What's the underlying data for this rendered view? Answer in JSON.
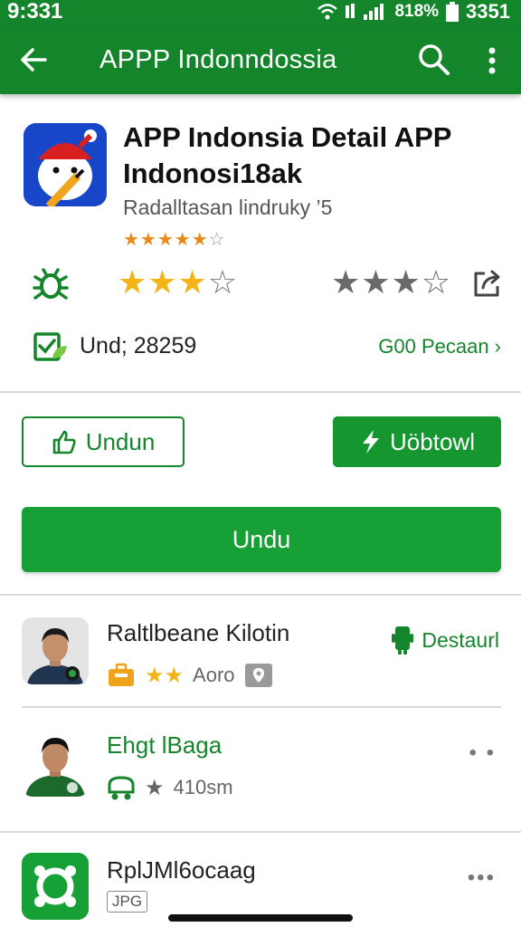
{
  "status_bar": {
    "time": "9:331",
    "battery_percent": "818%",
    "right_time": "3351",
    "icons": [
      "wifi-icon",
      "signal-icon",
      "battery-icon"
    ]
  },
  "app_bar": {
    "title": "APPP Indonndossia",
    "icons": [
      "back-arrow-icon",
      "search-icon",
      "more-vert-icon"
    ]
  },
  "app": {
    "title": "APP Indonsia Detail APP Indonosi18ak",
    "developer": "Radalltasan lindruky ’5",
    "small_rating": {
      "filled": "★★★★★",
      "empty": "☆"
    },
    "gold_rating": {
      "filled": "★★★",
      "empty": "☆"
    },
    "grey_rating": {
      "filled": "★★★",
      "empty": "☆"
    },
    "downloads": "Und; 28259",
    "more_link": "G00 Pecaan ›"
  },
  "buttons": {
    "outline_label": "Undun",
    "solid_label": "Uöbtowl",
    "primary_label": "Undu"
  },
  "list": [
    {
      "name": "Raltlbeane Kilotin",
      "stars": "★★",
      "meta_text": "Aoro",
      "action_label": "Destaurl"
    },
    {
      "name": "Ehgt lBaga",
      "star": "★",
      "meta_text": "410sm",
      "menu": "• •"
    },
    {
      "name": "RplJMl6ocaag",
      "tag": "JPG",
      "menu": "•••"
    }
  ],
  "colors": {
    "primary_green": "#15852c",
    "button_green": "#17a035",
    "star_gold": "#f2b417",
    "small_star_orange": "#e8891a"
  }
}
